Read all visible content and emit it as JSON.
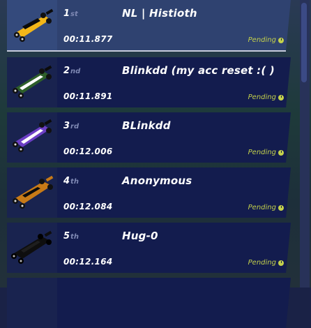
{
  "leaderboard": [
    {
      "rank": "1",
      "suffix": "st",
      "name": "NL | Histioth",
      "time": "00:11.877",
      "status": "Pending",
      "car_color": "#f2b619"
    },
    {
      "rank": "2",
      "suffix": "nd",
      "name": "Blinkdd (my acc reset :( )",
      "time": "00:11.891",
      "status": "Pending",
      "car_color": "#2e5f2a"
    },
    {
      "rank": "3",
      "suffix": "rd",
      "name": "BLinkdd",
      "time": "00:12.006",
      "status": "Pending",
      "car_color": "#6c3fc4"
    },
    {
      "rank": "4",
      "suffix": "th",
      "name": "Anonymous",
      "time": "00:12.084",
      "status": "Pending",
      "car_color": "#c77a17"
    },
    {
      "rank": "5",
      "suffix": "th",
      "name": "Hug-0",
      "time": "00:12.164",
      "status": "Pending",
      "car_color": "#0e0e0e"
    }
  ]
}
